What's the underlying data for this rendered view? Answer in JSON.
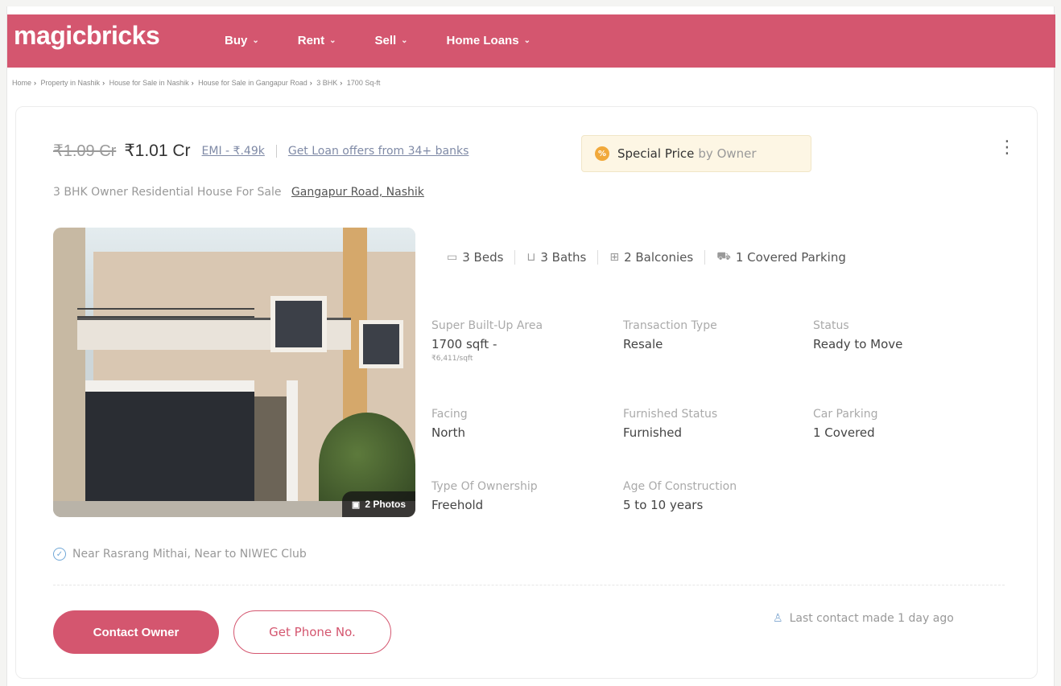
{
  "header": {
    "logo": "magicbricks",
    "nav": [
      {
        "label": "Buy"
      },
      {
        "label": "Rent"
      },
      {
        "label": "Sell"
      },
      {
        "label": "Home Loans"
      }
    ],
    "brand_color": "#d4566f"
  },
  "breadcrumb": [
    "Home",
    "Property in Nashik",
    "House for Sale in Nashik",
    "House for Sale in Gangapur Road",
    "3 BHK",
    "1700 Sq-ft"
  ],
  "listing": {
    "old_price": "₹1.09 Cr",
    "price": "₹1.01 Cr",
    "emi": "EMI - ₹.49k",
    "loan_link": "Get Loan offers from 34+ banks",
    "special_strong": "Special Price",
    "special_light": "by Owner",
    "subtitle": "3 BHK Owner Residential House For Sale",
    "location": "Gangapur Road, Nashik",
    "photos_label": "2 Photos",
    "features": [
      {
        "icon": "bed-icon",
        "label": "3 Beds"
      },
      {
        "icon": "bath-icon",
        "label": "3 Baths"
      },
      {
        "icon": "balcony-icon",
        "label": "2 Balconies"
      },
      {
        "icon": "car-icon",
        "label": "1 Covered Parking"
      }
    ],
    "details": {
      "area": {
        "label": "Super Built-Up Area",
        "value": "1700 sqft -",
        "sub": "₹6,411/sqft"
      },
      "transaction": {
        "label": "Transaction Type",
        "value": "Resale"
      },
      "status": {
        "label": "Status",
        "value": "Ready to Move"
      },
      "facing": {
        "label": "Facing",
        "value": "North"
      },
      "furnished": {
        "label": "Furnished Status",
        "value": "Furnished"
      },
      "car_parking": {
        "label": "Car Parking",
        "value": "1 Covered"
      },
      "ownership": {
        "label": "Type Of Ownership",
        "value": "Freehold"
      },
      "age": {
        "label": "Age Of Construction",
        "value": "5 to 10 years"
      }
    },
    "near": "Near Rasrang Mithai, Near to NIWEC Club",
    "contact_owner": "Contact Owner",
    "get_phone": "Get Phone No.",
    "last_contact": "Last contact made 1 day ago"
  }
}
